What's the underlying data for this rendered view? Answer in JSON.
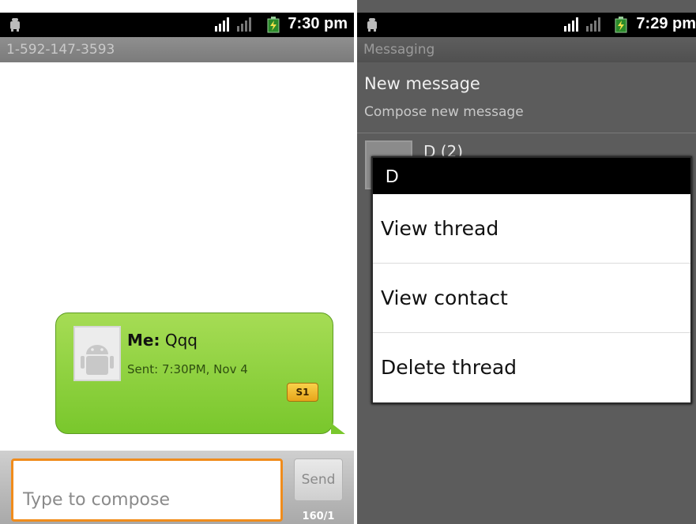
{
  "left": {
    "status": {
      "time": "7:30 pm"
    },
    "title": "1-592-147-3593",
    "message": {
      "sender": "Me:",
      "text": "Qqq",
      "sent": "Sent: 7:30PM, Nov 4",
      "sim_badge": "S1"
    },
    "compose": {
      "placeholder": "Type to compose",
      "send_label": "Send",
      "char_count": "160/1"
    }
  },
  "right": {
    "status": {
      "time": "7:29 pm"
    },
    "title": "Messaging",
    "new_message": {
      "title": "New message",
      "subtitle": "Compose new message"
    },
    "thread": {
      "name": "D (2)"
    },
    "dialog": {
      "title": "D",
      "items": [
        "View thread",
        "View contact",
        "Delete thread"
      ]
    }
  },
  "colors": {
    "bubble": "#79c72c",
    "compose_focus": "#f08c1c",
    "sim_badge": "#e8a51b"
  }
}
